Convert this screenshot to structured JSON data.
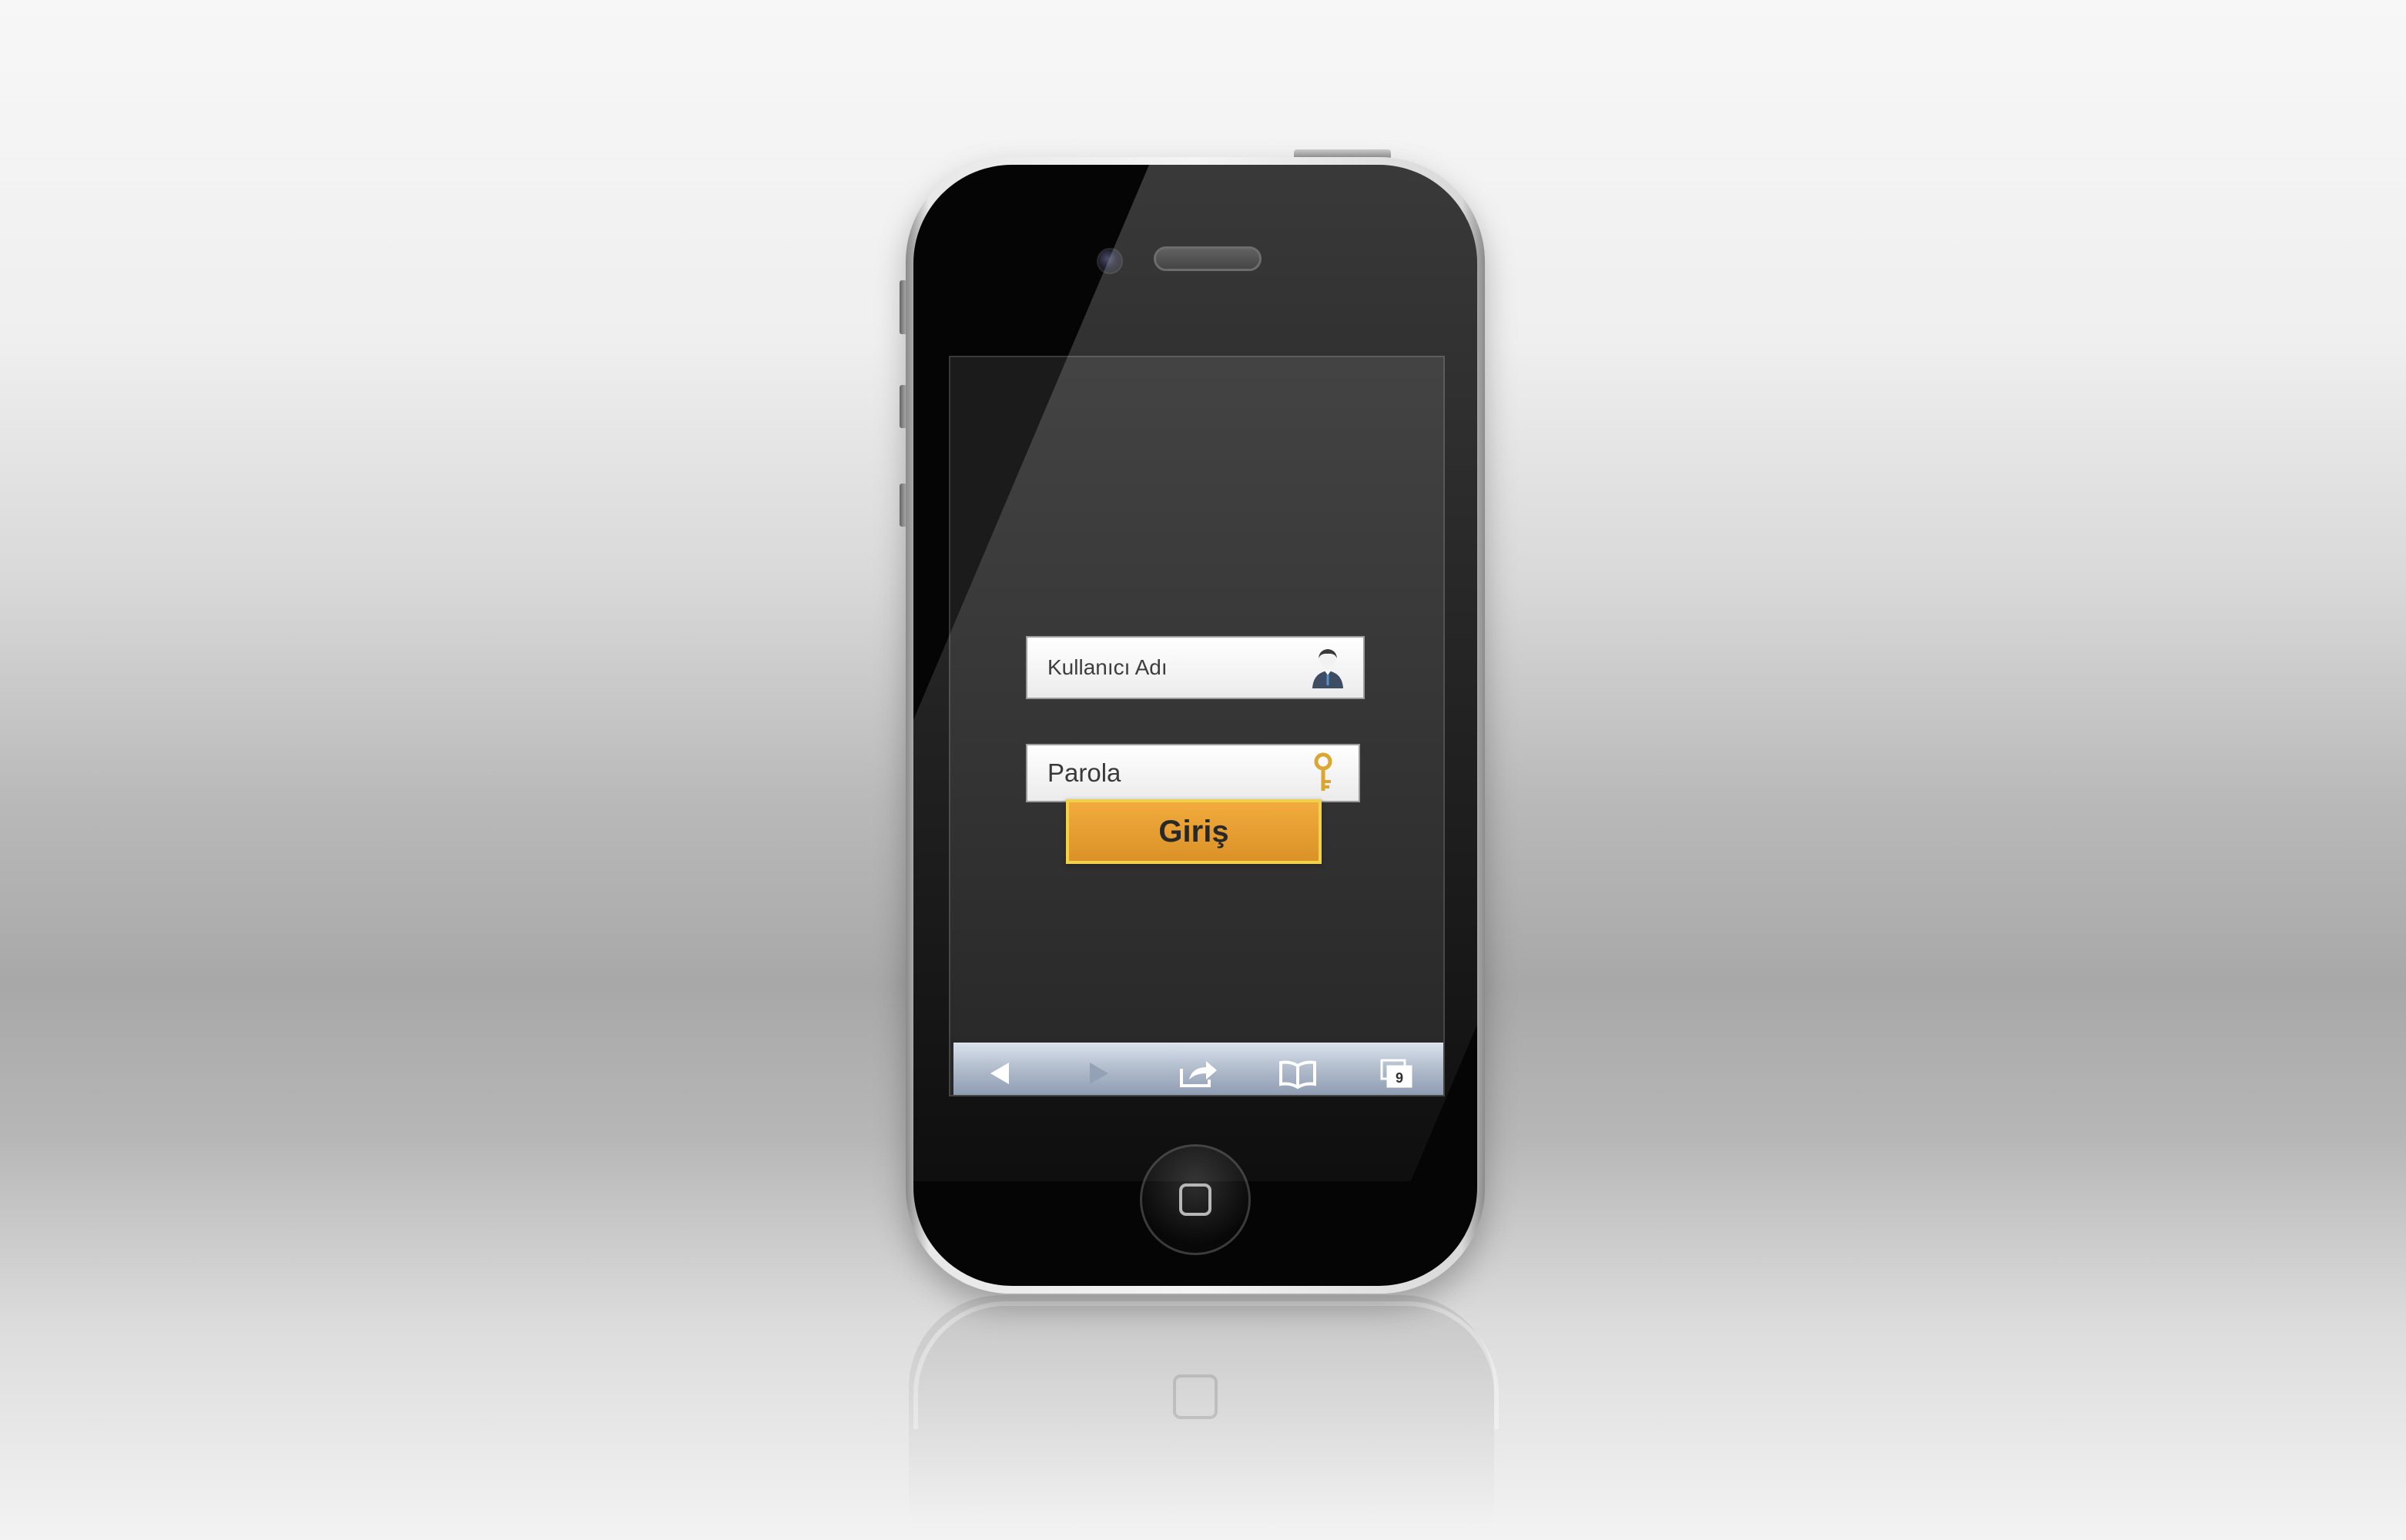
{
  "login_form": {
    "username_placeholder": "Kullanıcı Adı",
    "password_placeholder": "Parola",
    "submit_label": "Giriş"
  },
  "toolbar": {
    "items": [
      {
        "name": "back-icon",
        "label": ""
      },
      {
        "name": "forward-icon",
        "label": ""
      },
      {
        "name": "share-icon",
        "label": ""
      },
      {
        "name": "bookmarks-icon",
        "label": ""
      },
      {
        "name": "tabs-icon",
        "label": "9"
      }
    ]
  },
  "colors": {
    "accent": "#D78712",
    "accent_border": "#F1CC35",
    "screen_bg": "#1B1B1B",
    "toolbar_top": "#D7DFEB",
    "toolbar_bottom": "#7E8EA7"
  }
}
